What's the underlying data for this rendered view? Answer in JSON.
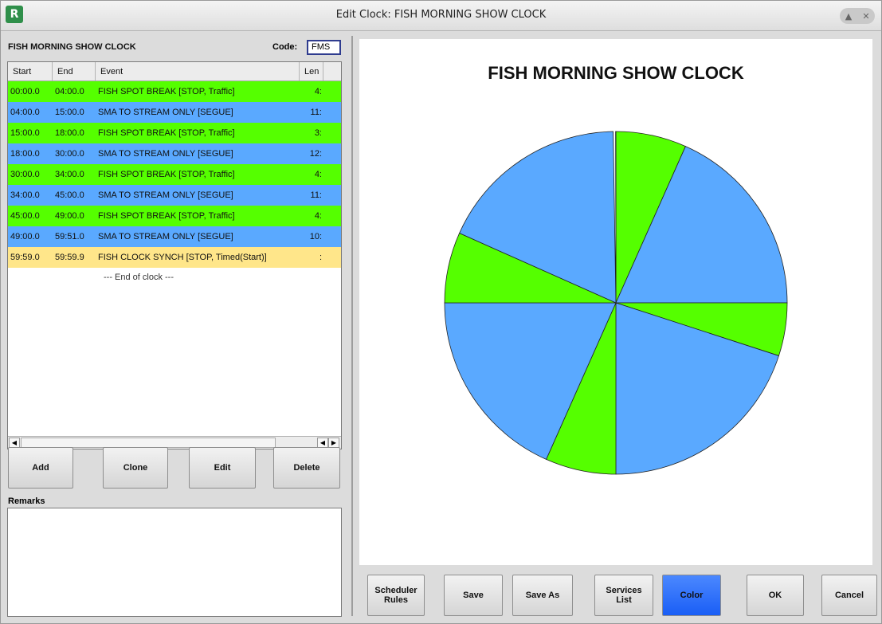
{
  "window": {
    "title": "Edit Clock: FISH MORNING SHOW CLOCK",
    "icon": "app-logo-icon"
  },
  "clock": {
    "name": "FISH MORNING SHOW CLOCK",
    "code_label": "Code:",
    "code_value": "FMS"
  },
  "table": {
    "headers": [
      "Start",
      "End",
      "Event",
      "Len"
    ],
    "rows": [
      {
        "start": "00:00.0",
        "end": "04:00.0",
        "event": "FISH SPOT BREAK [STOP, Traffic]",
        "len": "4:",
        "color": "green"
      },
      {
        "start": "04:00.0",
        "end": "15:00.0",
        "event": "SMA TO STREAM ONLY [SEGUE]",
        "len": "11:",
        "color": "blue"
      },
      {
        "start": "15:00.0",
        "end": "18:00.0",
        "event": "FISH SPOT BREAK [STOP, Traffic]",
        "len": "3:",
        "color": "green"
      },
      {
        "start": "18:00.0",
        "end": "30:00.0",
        "event": "SMA TO STREAM ONLY [SEGUE]",
        "len": "12:",
        "color": "blue"
      },
      {
        "start": "30:00.0",
        "end": "34:00.0",
        "event": "FISH SPOT BREAK [STOP, Traffic]",
        "len": "4:",
        "color": "green"
      },
      {
        "start": "34:00.0",
        "end": "45:00.0",
        "event": "SMA TO STREAM ONLY [SEGUE]",
        "len": "11:",
        "color": "blue"
      },
      {
        "start": "45:00.0",
        "end": "49:00.0",
        "event": "FISH SPOT BREAK [STOP, Traffic]",
        "len": "4:",
        "color": "green"
      },
      {
        "start": "49:00.0",
        "end": "59:51.0",
        "event": "SMA TO STREAM ONLY [SEGUE]",
        "len": "10:",
        "color": "blue"
      },
      {
        "start": "59:59.0",
        "end": "59:59.9",
        "event": "FISH CLOCK SYNCH [STOP, Timed(Start)]",
        "len": ":",
        "color": "yellow"
      }
    ],
    "end_text": "--- End of clock ---"
  },
  "buttons": {
    "add": "Add",
    "clone": "Clone",
    "edit": "Edit",
    "delete": "Delete"
  },
  "remarks": {
    "label": "Remarks",
    "value": ""
  },
  "bottom_buttons": {
    "scheduler_rules": "Scheduler\nRules",
    "save": "Save",
    "save_as": "Save As",
    "services_list": "Services\nList",
    "color": "Color",
    "ok": "OK",
    "cancel": "Cancel"
  },
  "colors": {
    "green": "#55ff00",
    "blue": "#5aa9ff",
    "yellow": "#ffe68a",
    "accent": "#1a5ef5"
  },
  "chart_data": {
    "type": "pie",
    "title": "FISH MORNING SHOW CLOCK",
    "slices": [
      {
        "start_min": 0,
        "end_min": 4,
        "color": "green"
      },
      {
        "start_min": 4,
        "end_min": 15,
        "color": "blue"
      },
      {
        "start_min": 15,
        "end_min": 18,
        "color": "green"
      },
      {
        "start_min": 18,
        "end_min": 30,
        "color": "blue"
      },
      {
        "start_min": 30,
        "end_min": 34,
        "color": "green"
      },
      {
        "start_min": 34,
        "end_min": 45,
        "color": "blue"
      },
      {
        "start_min": 45,
        "end_min": 49,
        "color": "green"
      },
      {
        "start_min": 49,
        "end_min": 59.85,
        "color": "blue"
      },
      {
        "start_min": 59.983,
        "end_min": 59.998,
        "color": "yellow"
      }
    ]
  }
}
